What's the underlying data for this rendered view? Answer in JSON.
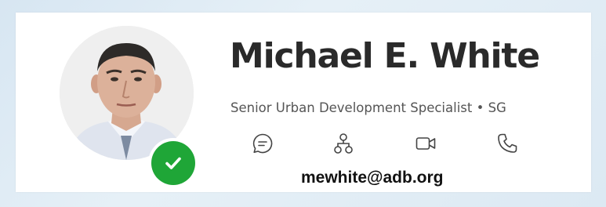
{
  "profile": {
    "name": "Michael E. White",
    "title": "Senior Urban Development Specialist • SG",
    "email": "mewhite@adb.org",
    "presence": "available",
    "presence_color": "#1fa637"
  },
  "actions": [
    {
      "icon": "chat-icon"
    },
    {
      "icon": "org-chart-icon"
    },
    {
      "icon": "video-call-icon"
    },
    {
      "icon": "phone-icon"
    }
  ]
}
